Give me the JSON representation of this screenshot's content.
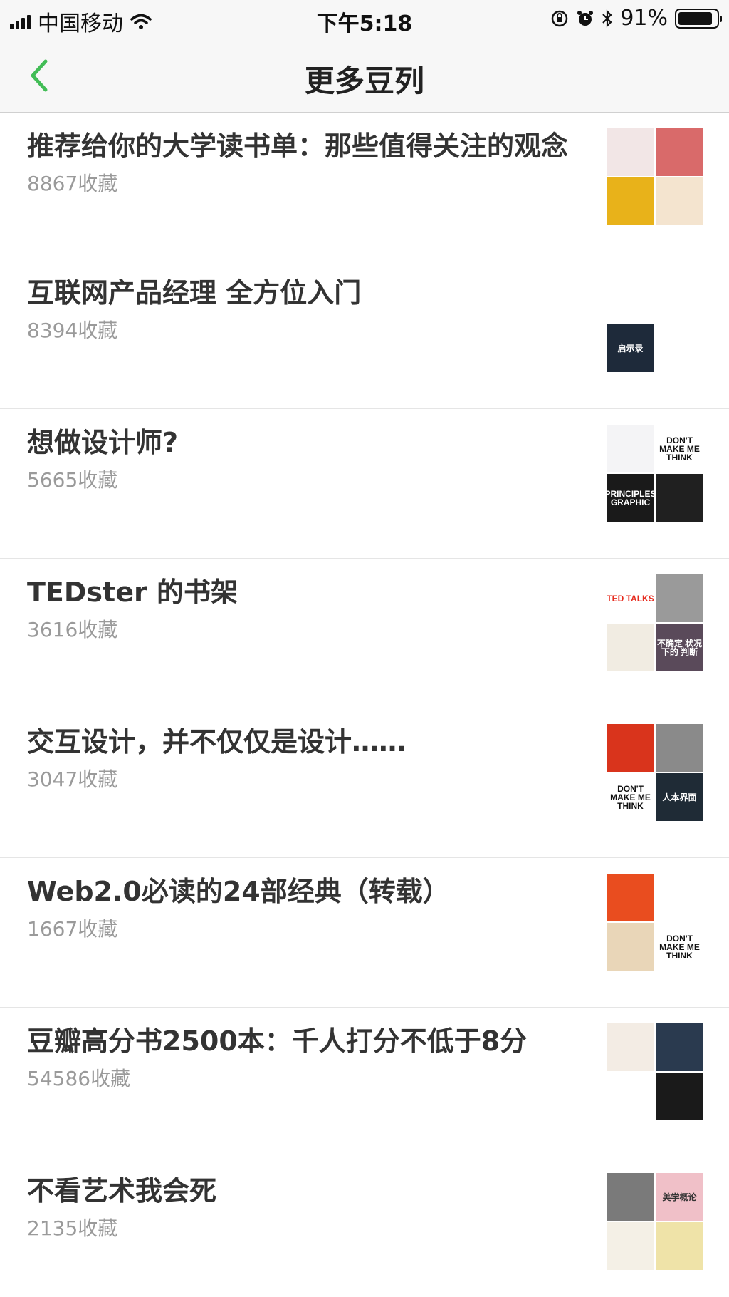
{
  "status_bar": {
    "carrier": "中国移动",
    "time": "下午5:18",
    "battery": "91%",
    "battery_level": 0.91
  },
  "nav": {
    "title": "更多豆列"
  },
  "items": [
    {
      "title": "推荐给你的大学读书单：那些值得关注的观念",
      "count": "8867收藏",
      "covers": [
        {
          "bg": "#f2e6e6",
          "fg": "#c0392b",
          "text": ""
        },
        {
          "bg": "#d96a6a",
          "fg": "#ffffff",
          "text": ""
        },
        {
          "bg": "#e8b21a",
          "fg": "#b51d1d",
          "text": ""
        },
        {
          "bg": "#f4e4cf",
          "fg": "#b89a6e",
          "text": ""
        }
      ]
    },
    {
      "title": "互联网产品经理 全方位入门",
      "count": "8394收藏",
      "covers": [
        {
          "bg": "#ffffff",
          "fg": "#d4a017",
          "text": ""
        },
        {
          "bg": "#ffffff",
          "fg": "#e0a800",
          "text": ""
        },
        {
          "bg": "#1e2a3a",
          "fg": "#ffffff",
          "text": "启示录"
        },
        {
          "bg": "#ffffff",
          "fg": "#e08a00",
          "text": ""
        }
      ]
    },
    {
      "title": "想做设计师?",
      "count": "5665收藏",
      "covers": [
        {
          "bg": "#f4f4f6",
          "fg": "#2a3f8f",
          "text": ""
        },
        {
          "bg": "#ffffff",
          "fg": "#111111",
          "text": "DON'T MAKE ME THINK"
        },
        {
          "bg": "#1a1a1a",
          "fg": "#ffffff",
          "text": "PRINCIPLES GRAPHIC"
        },
        {
          "bg": "#202020",
          "fg": "#e04a2a",
          "text": ""
        }
      ]
    },
    {
      "title": "TEDster 的书架",
      "count": "3616收藏",
      "covers": [
        {
          "bg": "#ffffff",
          "fg": "#e62b1e",
          "text": "TED TALKS"
        },
        {
          "bg": "#9a9a9a",
          "fg": "#ffffff",
          "text": ""
        },
        {
          "bg": "#f1ece2",
          "fg": "#555555",
          "text": ""
        },
        {
          "bg": "#5a4a5a",
          "fg": "#ffffff",
          "text": "不确定 状况下的 判断"
        }
      ]
    },
    {
      "title": "交互设计，并不仅仅是设计……",
      "count": "3047收藏",
      "covers": [
        {
          "bg": "#d9341c",
          "fg": "#ffffff",
          "text": ""
        },
        {
          "bg": "#8a8a8a",
          "fg": "#ffffff",
          "text": ""
        },
        {
          "bg": "#ffffff",
          "fg": "#111111",
          "text": "DON'T MAKE ME THINK"
        },
        {
          "bg": "#1f2b36",
          "fg": "#ffffff",
          "text": "人本界面"
        }
      ]
    },
    {
      "title": "Web2.0必读的24部经典（转载）",
      "count": "1667收藏",
      "covers": [
        {
          "bg": "#e94d1f",
          "fg": "#ffffff",
          "text": ""
        },
        {
          "bg": "#ffffff",
          "fg": "#111111",
          "text": ""
        },
        {
          "bg": "#e9d6b8",
          "fg": "#7a3a1a",
          "text": ""
        },
        {
          "bg": "#ffffff",
          "fg": "#111111",
          "text": "DON'T MAKE ME THINK"
        }
      ]
    },
    {
      "title": "豆瓣高分书2500本：千人打分不低于8分",
      "count": "54586收藏",
      "covers": [
        {
          "bg": "#f3ece4",
          "fg": "#a08060",
          "text": ""
        },
        {
          "bg": "#2a3a4f",
          "fg": "#ffffff",
          "text": ""
        },
        {
          "bg": "#ffffff",
          "fg": "#333333",
          "text": ""
        },
        {
          "bg": "#1a1a1a",
          "fg": "#ffffff",
          "text": ""
        }
      ]
    },
    {
      "title": "不看艺术我会死",
      "count": "2135收藏",
      "covers": [
        {
          "bg": "#7a7a7a",
          "fg": "#ffffff",
          "text": ""
        },
        {
          "bg": "#f0c0c8",
          "fg": "#333333",
          "text": "美学概论"
        },
        {
          "bg": "#f4f0e6",
          "fg": "#333333",
          "text": ""
        },
        {
          "bg": "#efe3a8",
          "fg": "#333333",
          "text": ""
        }
      ]
    }
  ]
}
